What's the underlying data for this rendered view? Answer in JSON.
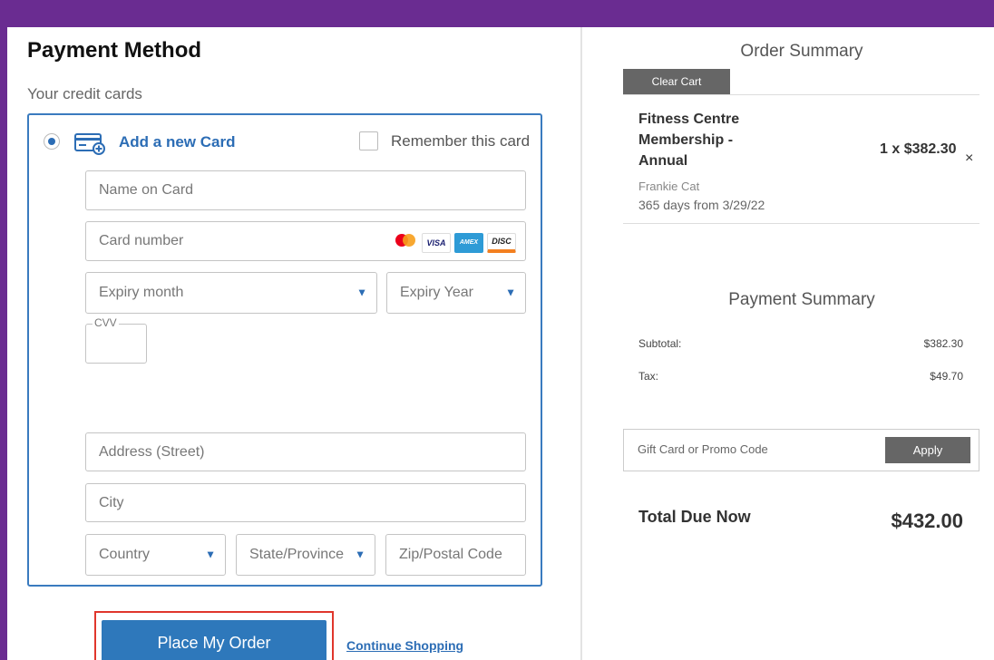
{
  "payment": {
    "title": "Payment Method",
    "credit_cards_label": "Your credit cards",
    "add_card_label": "Add a new Card",
    "remember_label": "Remember this card",
    "fields": {
      "name_on_card": "Name on Card",
      "card_number": "Card number",
      "expiry_month": "Expiry month",
      "expiry_year": "Expiry Year",
      "cvv": "CVV",
      "address": "Address (Street)",
      "city": "City",
      "country": "Country",
      "state": "State/Province",
      "zip": "Zip/Postal Code"
    },
    "card_logos": [
      "mastercard-logo",
      "visa-logo",
      "amex-logo",
      "discover-logo"
    ],
    "logo_text": {
      "visa": "VISA",
      "amex": "AMEX",
      "discover": "DISC"
    },
    "place_order": "Place My Order",
    "continue_shopping": "Continue Shopping"
  },
  "order_summary": {
    "title": "Order Summary",
    "clear_cart": "Clear Cart",
    "item": {
      "name": "Fitness Centre Membership - Annual",
      "price": "1 x $382.30",
      "remove": "×",
      "owner": "Frankie Cat",
      "duration": "365 days from 3/29/22"
    }
  },
  "payment_summary": {
    "title": "Payment Summary",
    "subtotal_label": "Subtotal:",
    "subtotal_value": "$382.30",
    "tax_label": "Tax:",
    "tax_value": "$49.70",
    "promo_label": "Gift Card or Promo Code",
    "apply": "Apply",
    "total_label": "Total Due Now",
    "total_value": "$432.00"
  },
  "colors": {
    "background": "#6a2c91",
    "accent": "#2c6db5",
    "button_primary": "#2e78bb",
    "highlight": "#e0362c",
    "button_gray": "#666666"
  }
}
